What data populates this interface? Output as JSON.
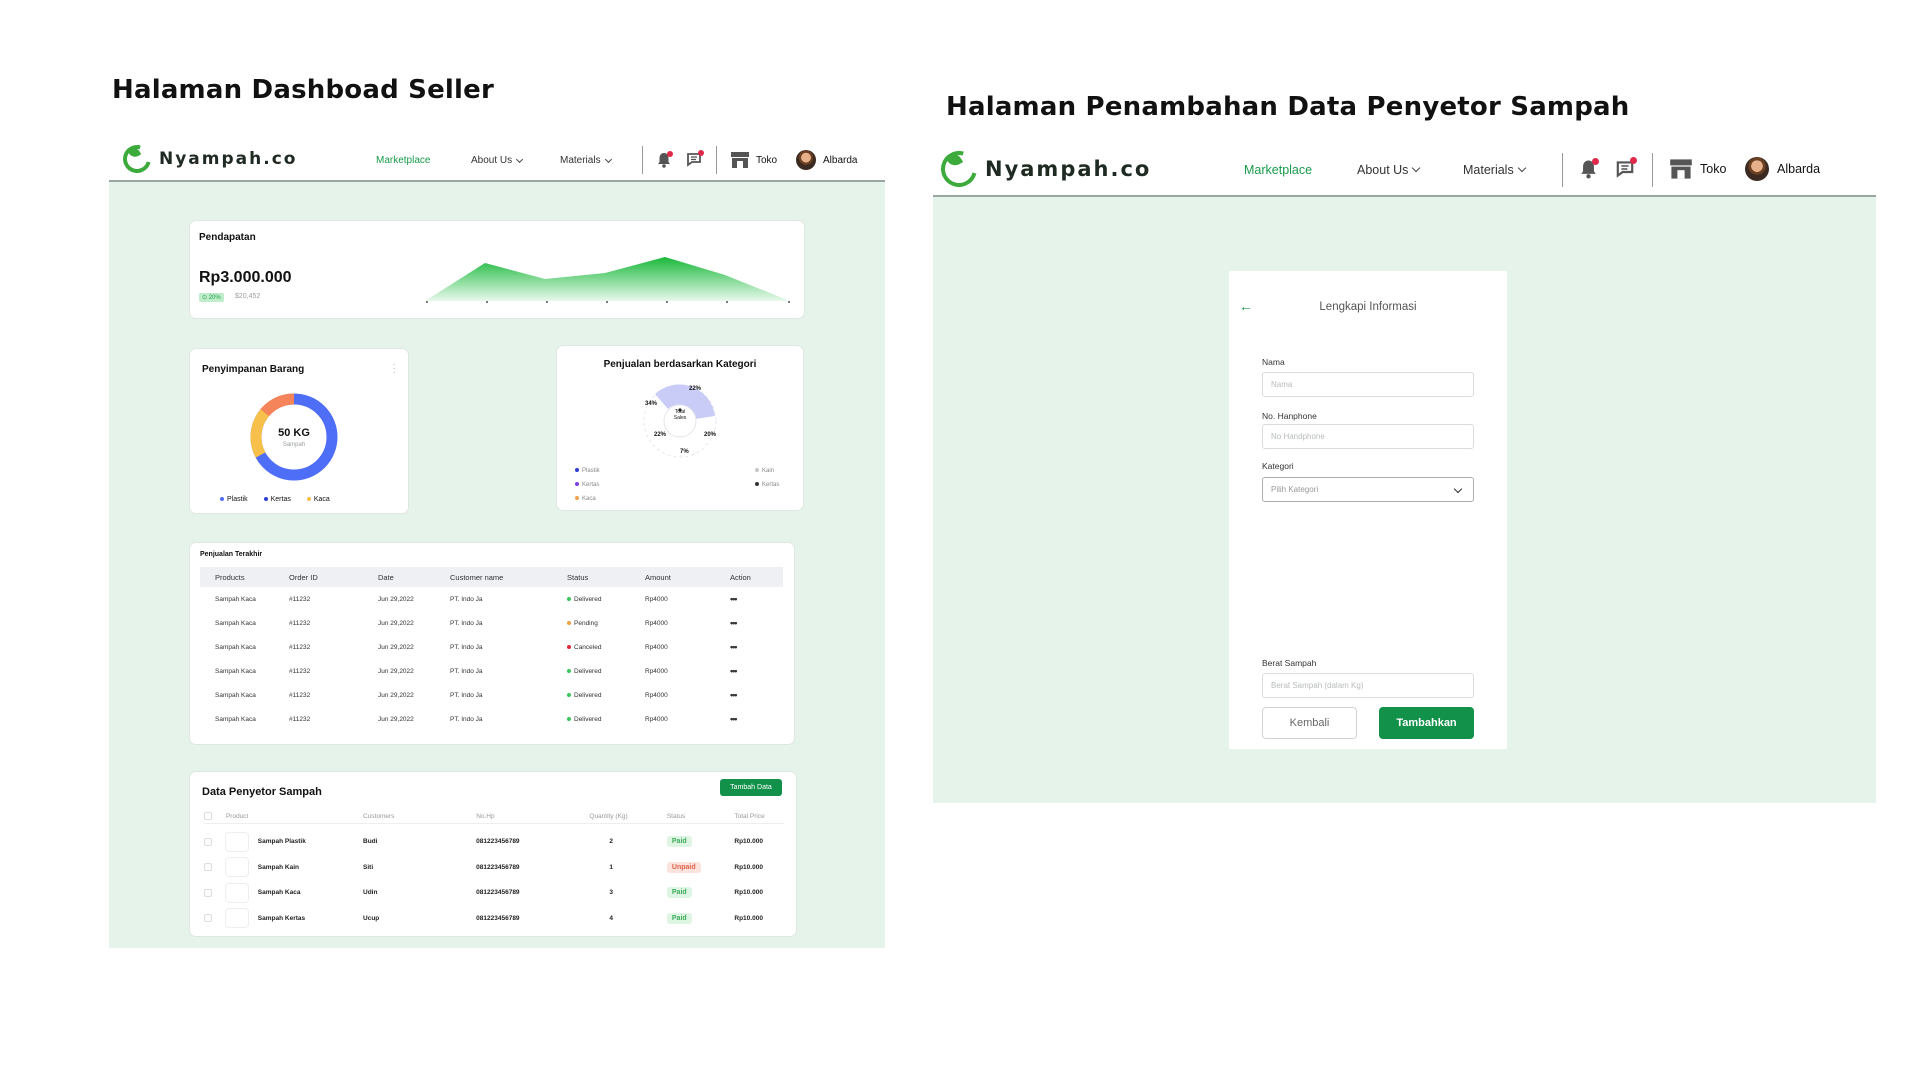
{
  "captions": {
    "left": "Halaman Dashboad Seller",
    "right": "Halaman Penambahan Data Penyetor Sampah"
  },
  "nav": {
    "brand": "Nyampah.co",
    "marketplace": "Marketplace",
    "about": "About Us",
    "materials": "Materials",
    "store": "Toko",
    "user": "Albarda"
  },
  "dashboard": {
    "revenue": {
      "title": "Pendapatan",
      "amount": "Rp3.000.000",
      "change": "20%",
      "sub": "$20,452"
    },
    "storage": {
      "title": "Penyimpanan Barang",
      "center_value": "50 KG",
      "center_label": "Sampah",
      "legend": [
        {
          "label": "Plastik",
          "color": "#4f6ef7"
        },
        {
          "label": "Kertas",
          "color": "#2d3fd8"
        },
        {
          "label": "Kaca",
          "color": "#f7c04a"
        }
      ]
    },
    "category_sales": {
      "title": "Penjualan berdasarkan Kategori",
      "center_label_1": "Total",
      "center_label_2": "Sales",
      "pct": [
        "22%",
        "20%",
        "7%",
        "22%",
        "34%"
      ],
      "legend_left": [
        {
          "label": "Plastik",
          "color": "#2d3fd8"
        },
        {
          "label": "Kertas",
          "color": "#7b3fe0"
        },
        {
          "label": "Kaca",
          "color": "#f7a04a"
        }
      ],
      "legend_right": [
        {
          "label": "Kain",
          "color": "#c8c8c8"
        },
        {
          "label": "Kertas",
          "color": "#333333"
        }
      ]
    },
    "recent_sales": {
      "title": "Penjualan Terakhir",
      "headers": [
        "Products",
        "Order ID",
        "Date",
        "Customer name",
        "Status",
        "Amount",
        "Action"
      ],
      "rows": [
        {
          "product": "Sampah Kaca",
          "order": "#11232",
          "date": "Jun 29,2022",
          "customer": "PT. Indo Ja",
          "status": "Delivered",
          "status_color": "#3cc85a",
          "amount": "Rp4000",
          "action": "•••"
        },
        {
          "product": "Sampah Kaca",
          "order": "#11232",
          "date": "Jun 29,2022",
          "customer": "PT. Indo Ja",
          "status": "Pending",
          "status_color": "#f0a23c",
          "amount": "Rp4000",
          "action": "•••"
        },
        {
          "product": "Sampah Kaca",
          "order": "#11232",
          "date": "Jun 29,2022",
          "customer": "PT. Indo Ja",
          "status": "Canceled",
          "status_color": "#e0283c",
          "amount": "Rp4000",
          "action": "•••"
        },
        {
          "product": "Sampah Kaca",
          "order": "#11232",
          "date": "Jun 29,2022",
          "customer": "PT. Indo Ja",
          "status": "Delivered",
          "status_color": "#3cc85a",
          "amount": "Rp4000",
          "action": "•••"
        },
        {
          "product": "Sampah Kaca",
          "order": "#11232",
          "date": "Jun 29,2022",
          "customer": "PT. Indo Ja",
          "status": "Delivered",
          "status_color": "#3cc85a",
          "amount": "Rp4000",
          "action": "•••"
        },
        {
          "product": "Sampah Kaca",
          "order": "#11232",
          "date": "Jun 29,2022",
          "customer": "PT. Indo Ja",
          "status": "Delivered",
          "status_color": "#3cc85a",
          "amount": "Rp4000",
          "action": "•••"
        }
      ]
    },
    "depositors": {
      "title": "Data Penyetor Sampah",
      "add_button": "Tambah Data",
      "headers": [
        "Product",
        "Customers",
        "No.Hp",
        "Quantity (Kg)",
        "Status",
        "Total Price"
      ],
      "rows": [
        {
          "product": "Sampah Plastik",
          "customer": "Budi",
          "phone": "081223456789",
          "qty": "2",
          "status": "Paid",
          "paid": true,
          "price": "Rp10.000"
        },
        {
          "product": "Sampah Kain",
          "customer": "Siti",
          "phone": "081223456789",
          "qty": "1",
          "status": "Unpaid",
          "paid": false,
          "price": "Rp10.000"
        },
        {
          "product": "Sampah Kaca",
          "customer": "Udin",
          "phone": "081223456789",
          "qty": "3",
          "status": "Paid",
          "paid": true,
          "price": "Rp10.000"
        },
        {
          "product": "Sampah Kertas",
          "customer": "Ucup",
          "phone": "081223456789",
          "qty": "4",
          "status": "Paid",
          "paid": true,
          "price": "Rp10.000"
        }
      ]
    }
  },
  "form": {
    "title": "Lengkapi Informasi",
    "name_label": "Nama",
    "name_placeholder": "Nama",
    "phone_label": "No. Hanphone",
    "phone_placeholder": "No Handphone",
    "category_label": "Kategori",
    "category_value": "Pilih Kategori",
    "weight_label": "Berat Sampah",
    "weight_placeholder": "Berat Sampah (dalam Kg)",
    "back_button": "Kembali",
    "submit_button": "Tambahkan"
  },
  "colors": {
    "brand_green": "#1a9a4b",
    "page_bg": "#e6f3ea",
    "button_green": "#12914a"
  }
}
